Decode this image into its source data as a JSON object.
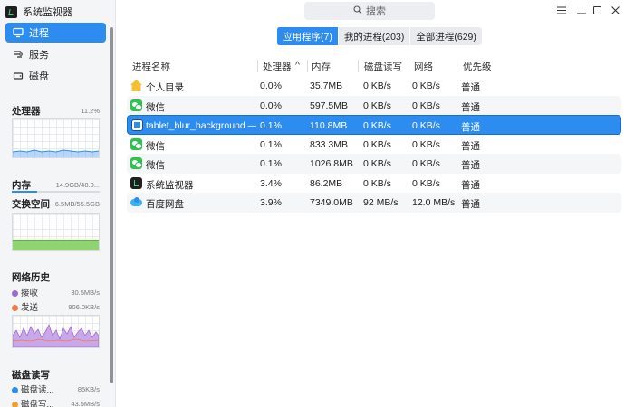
{
  "app": {
    "title": "系统监视器"
  },
  "sidebar": {
    "nav": [
      {
        "label": "进程",
        "icon": "process-icon",
        "active": true
      },
      {
        "label": "服务",
        "icon": "service-icon",
        "active": false
      },
      {
        "label": "磁盘",
        "icon": "disk-icon",
        "active": false
      }
    ],
    "cpu": {
      "title": "处理器",
      "value": "11.2%"
    },
    "memory": {
      "title": "内存",
      "value": "14.9GB/48.0..."
    },
    "swap": {
      "title": "交换空间",
      "value": "6.5MB/55.5GB"
    },
    "network": {
      "title": "网络历史",
      "receive_label": "接收",
      "receive_value": "30.5MB/s",
      "send_label": "发送",
      "send_value": "906.0KB/s"
    },
    "disk_io": {
      "title": "磁盘读写",
      "read_label": "磁盘读...",
      "read_value": "85KB/s",
      "write_label": "磁盘写...",
      "write_value": "43.5MB/s"
    }
  },
  "search": {
    "placeholder": "搜索"
  },
  "tabs": [
    {
      "label": "应用程序(7)",
      "active": true
    },
    {
      "label": "我的进程(203)",
      "active": false
    },
    {
      "label": "全部进程(629)",
      "active": false
    }
  ],
  "table": {
    "headers": {
      "name": "进程名称",
      "cpu": "处理器",
      "sort_indicator": "^",
      "memory": "内存",
      "disk": "磁盘读写",
      "network": "网络",
      "priority": "优先级"
    },
    "rows": [
      {
        "icon": "home-folder-icon",
        "name": "个人目录",
        "cpu": "0.0%",
        "memory": "35.7MB",
        "disk": "0 KB/s",
        "network": "0 KB/s",
        "priority": "普通"
      },
      {
        "icon": "wechat-icon",
        "name": "微信",
        "cpu": "0.0%",
        "memory": "597.5MB",
        "disk": "0 KB/s",
        "network": "0 KB/s",
        "priority": "普通"
      },
      {
        "icon": "tablet-icon",
        "name": "tablet_blur_background — ...",
        "cpu": "0.1%",
        "memory": "110.8MB",
        "disk": "0 KB/s",
        "network": "0 KB/s",
        "priority": "普通"
      },
      {
        "icon": "wechat-icon",
        "name": "微信",
        "cpu": "0.1%",
        "memory": "833.3MB",
        "disk": "0 KB/s",
        "network": "0 KB/s",
        "priority": "普通"
      },
      {
        "icon": "wechat-icon",
        "name": "微信",
        "cpu": "0.1%",
        "memory": "1026.8MB",
        "disk": "0 KB/s",
        "network": "0 KB/s",
        "priority": "普通"
      },
      {
        "icon": "system-monitor-icon",
        "name": "系统监视器",
        "cpu": "3.4%",
        "memory": "86.2MB",
        "disk": "0 KB/s",
        "network": "0 KB/s",
        "priority": "普通"
      },
      {
        "icon": "baidu-netdisk-icon",
        "name": "百度网盘",
        "cpu": "3.9%",
        "memory": "7349.0MB",
        "disk": "92 MB/s",
        "network": "12.0 MB/s",
        "priority": "普通"
      }
    ]
  },
  "colors": {
    "accent": "#2d8cf0",
    "receive": "#9b6ad8",
    "send": "#f07a4a",
    "swap_fill": "#8fd470"
  }
}
